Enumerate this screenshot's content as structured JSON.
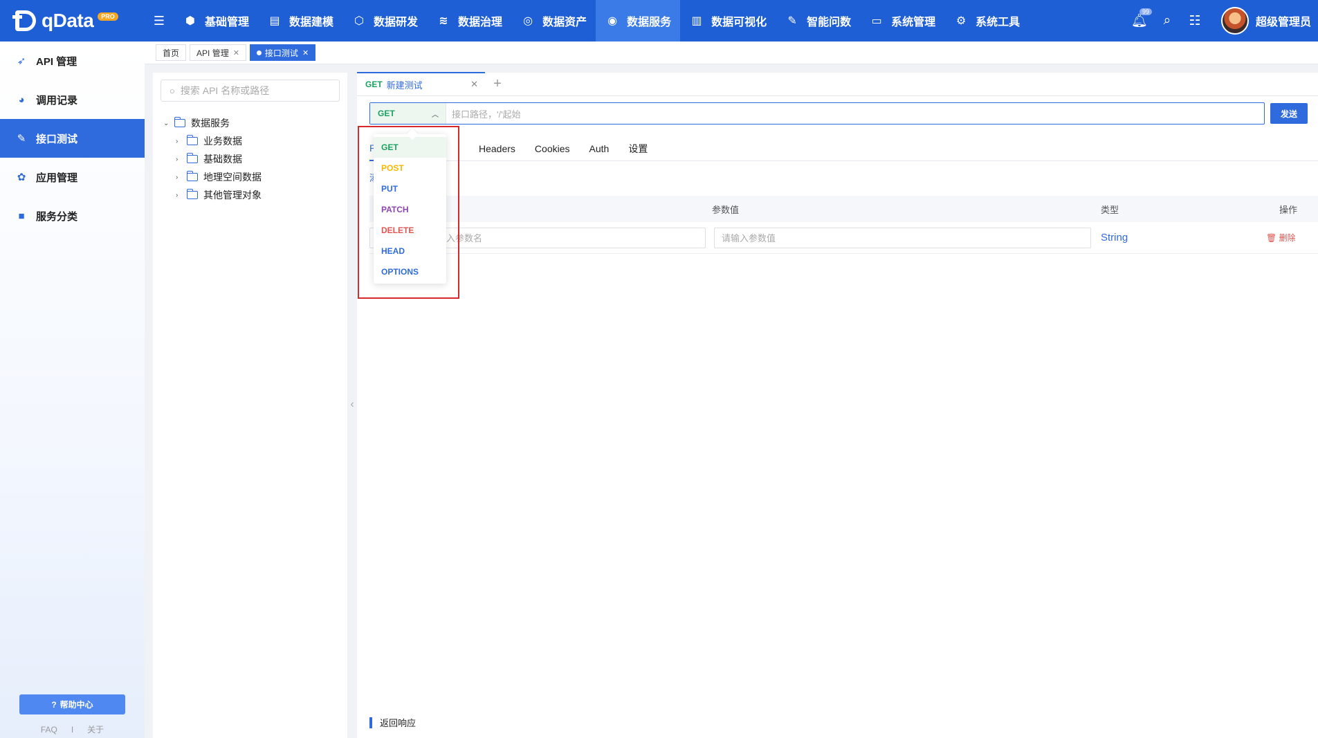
{
  "brand": {
    "name": "qData",
    "badge": "PRO"
  },
  "topnav": {
    "items": [
      {
        "label": "基础管理",
        "icon": "cube-icon"
      },
      {
        "label": "数据建模",
        "icon": "book-icon"
      },
      {
        "label": "数据研发",
        "icon": "box-icon"
      },
      {
        "label": "数据治理",
        "icon": "database-icon"
      },
      {
        "label": "数据资产",
        "icon": "target-icon"
      },
      {
        "label": "数据服务",
        "icon": "service-icon",
        "active": true
      },
      {
        "label": "数据可视化",
        "icon": "chart-icon"
      },
      {
        "label": "智能问数",
        "icon": "ai-icon"
      },
      {
        "label": "系统管理",
        "icon": "monitor-icon"
      },
      {
        "label": "系统工具",
        "icon": "gear-icon"
      }
    ],
    "notification_count": "99",
    "username": "超级管理员"
  },
  "sidebar": {
    "items": [
      {
        "label": "API 管理",
        "icon": "rocket-icon"
      },
      {
        "label": "调用记录",
        "icon": "record-icon"
      },
      {
        "label": "接口测试",
        "icon": "test-icon",
        "active": true
      },
      {
        "label": "应用管理",
        "icon": "apps-icon"
      },
      {
        "label": "服务分类",
        "icon": "category-icon"
      }
    ],
    "help_label": "帮助中心",
    "footer": {
      "faq": "FAQ",
      "separator": "I",
      "about": "关于"
    }
  },
  "page_tabs": [
    {
      "label": "首页"
    },
    {
      "label": "API 管理",
      "closable": true
    },
    {
      "label": "接口测试",
      "closable": true,
      "active": true
    }
  ],
  "tree": {
    "search_placeholder": "搜索 API 名称或路径",
    "root": "数据服务",
    "children": [
      "业务数据",
      "基础数据",
      "地理空间数据",
      "其他管理对象"
    ]
  },
  "request": {
    "tab": {
      "method": "GET",
      "title": "新建测试"
    },
    "method": "GET",
    "url_placeholder": "接口路径，'/'起始",
    "send_label": "发送",
    "sub_tabs": [
      "Headers",
      "Cookies",
      "Auth",
      "设置"
    ],
    "first_tab_partial": "P",
    "add_link_partial": "添",
    "table": {
      "columns": [
        "参数值",
        "类型",
        "操作"
      ],
      "row": {
        "name_placeholder": "入参数名",
        "value_placeholder": "请输入参数值",
        "type": "String",
        "delete_label": "删除"
      }
    },
    "response_label": "返回响应"
  },
  "method_dropdown": {
    "options": [
      {
        "label": "GET",
        "color": "#1aa260"
      },
      {
        "label": "POST",
        "color": "#f5b800"
      },
      {
        "label": "PUT",
        "color": "#2f6bdc"
      },
      {
        "label": "PATCH",
        "color": "#8e44ad"
      },
      {
        "label": "DELETE",
        "color": "#e0554f"
      },
      {
        "label": "HEAD",
        "color": "#2f6bdc"
      },
      {
        "label": "OPTIONS",
        "color": "#2f6bdc"
      }
    ],
    "selected": "GET"
  }
}
